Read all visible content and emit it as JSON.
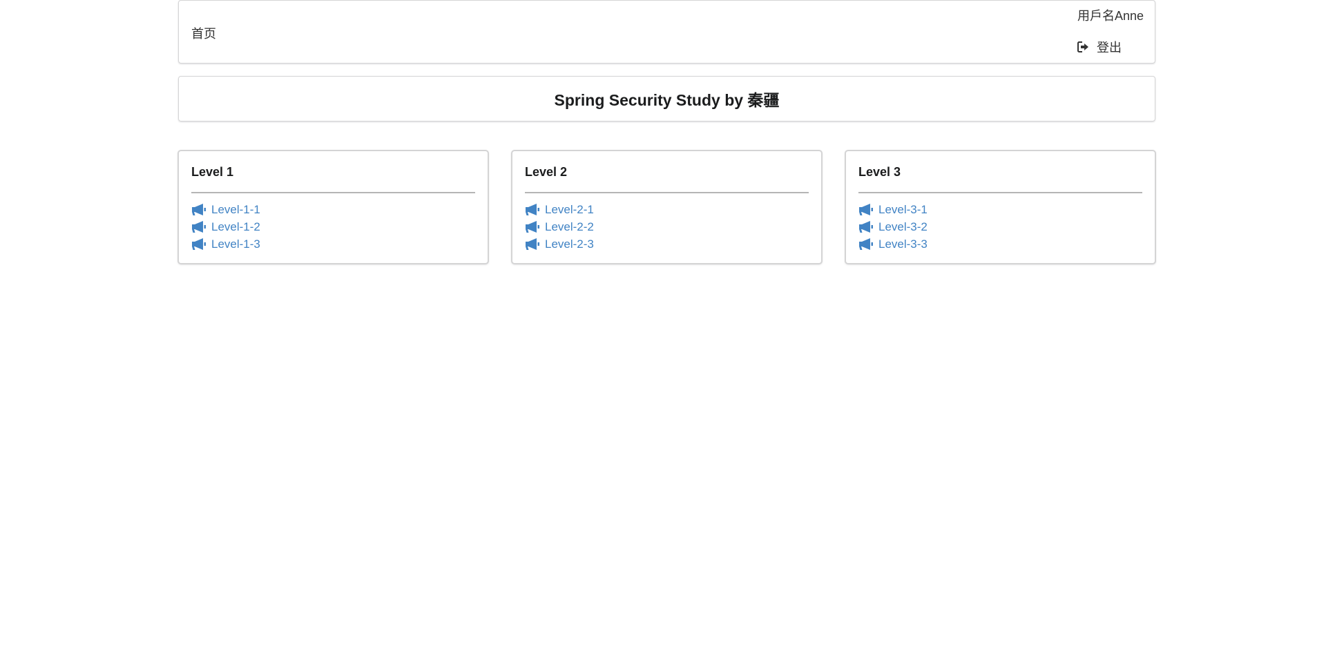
{
  "menu": {
    "home_label": "首页",
    "username": "用戶名Anne",
    "logout_label": "登出"
  },
  "title": "Spring Security Study by 秦疆",
  "levels": [
    {
      "title": "Level 1",
      "links": [
        "Level-1-1",
        "Level-1-2",
        "Level-1-3"
      ]
    },
    {
      "title": "Level 2",
      "links": [
        "Level-2-1",
        "Level-2-2",
        "Level-2-3"
      ]
    },
    {
      "title": "Level 3",
      "links": [
        "Level-3-1",
        "Level-3-2",
        "Level-3-3"
      ]
    }
  ],
  "colors": {
    "link": "#4183c4",
    "border": "#d4d4d5",
    "text": "#333333"
  },
  "icons": {
    "logout": "sign-out-icon",
    "link": "bullhorn-icon"
  }
}
